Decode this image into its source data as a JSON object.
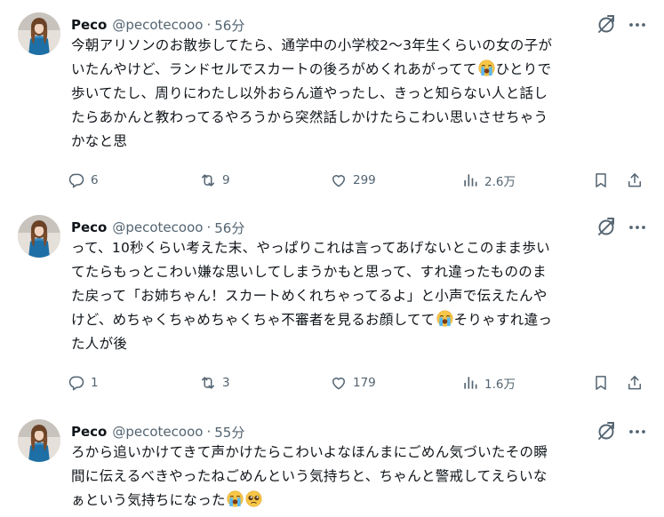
{
  "tweets": [
    {
      "name": "Peco",
      "handle": "@pecotecooo",
      "separator": "·",
      "time": "56分",
      "lines": [
        "今朝アリソンのお散歩してたら、通学中の小学校2〜3年生くらいの女の子が",
        "いたんやけど、ランドセルでスカートの後ろがめくれあがってて",
        "ひとりで",
        "歩いてたし、周りにわたし以外おらん道やったし、きっと知らない人と話し",
        "たらあかんと教わってるやろうから突然話しかけたらこわい思いさせちゃう",
        "かなと思"
      ],
      "stats": {
        "replies": "6",
        "reposts": "9",
        "likes": "299",
        "views": "2.6万"
      }
    },
    {
      "name": "Peco",
      "handle": "@pecotecooo",
      "separator": "·",
      "time": "56分",
      "lines": [
        "って、10秒くらい考えた末、やっぱりこれは言ってあげないとこのまま歩い",
        "てたらもっとこわい嫌な思いしてしまうかもと思って、すれ違ったもののま",
        "た戻って「お姉ちゃん！スカートめくれちゃってるよ」と小声で伝えたんや",
        "けど、めちゃくちゃめちゃくちゃ不審者を見るお顔してて",
        "そりゃすれ違っ",
        "た人が後"
      ],
      "stats": {
        "replies": "1",
        "reposts": "3",
        "likes": "179",
        "views": "1.6万"
      }
    },
    {
      "name": "Peco",
      "handle": "@pecotecooo",
      "separator": "·",
      "time": "55分",
      "lines": [
        "ろから追いかけてきて声かけたらこわいよなほんまにごめん気づいたその瞬",
        "間に伝えるべきやったねごめんという気持ちと、ちゃんと警戒してえらいな",
        "ぁという気持ちになった"
      ]
    }
  ],
  "icons": {
    "reply": "reply-icon",
    "repost": "repost-icon",
    "like": "heart-icon",
    "views": "views-chart-icon",
    "bookmark": "bookmark-icon",
    "share": "share-icon",
    "grok": "grok-icon",
    "more": "more-icon",
    "emoji_cry": "loudly-crying-face-emoji",
    "emoji_plead": "pleading-face-emoji"
  },
  "colors": {
    "text": "#0f1419",
    "muted": "#536471",
    "divider": "#eff3f4",
    "avatar_outfit": "#1d6fa5"
  }
}
